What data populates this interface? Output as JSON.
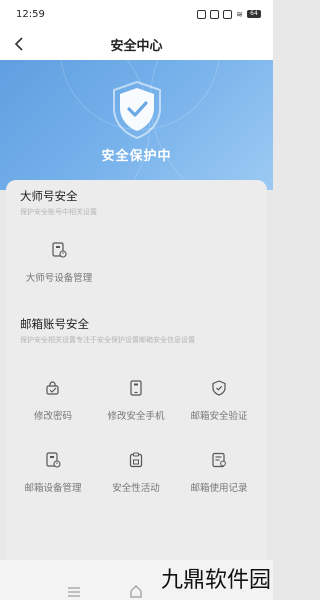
{
  "status_bar": {
    "time": "12:59",
    "battery": "64"
  },
  "nav": {
    "title": "安全中心"
  },
  "hero": {
    "title": "安全保护中"
  },
  "master_section": {
    "title": "大师号安全",
    "description": "保护安全账号中相关设置",
    "items": [
      {
        "label": "大师号设备管理",
        "icon": "device-lock-icon"
      }
    ]
  },
  "mail_section": {
    "title": "邮箱账号安全",
    "description": "保护安全相关设置专注于安全保护设置邮箱安全信息设置",
    "items": [
      {
        "label": "修改密码",
        "icon": "password-edit-icon"
      },
      {
        "label": "修改安全手机",
        "icon": "phone-icon"
      },
      {
        "label": "邮箱安全验证",
        "icon": "shield-check-icon"
      },
      {
        "label": "邮箱设备管理",
        "icon": "device-lock-icon"
      },
      {
        "label": "安全性活动",
        "icon": "clipboard-lock-icon"
      },
      {
        "label": "邮箱使用记录",
        "icon": "record-icon"
      }
    ]
  },
  "watermark": "九鼎软件园",
  "colors": {
    "hero_start": "#5f9ee0",
    "hero_end": "#9ccaf3",
    "panel": "#ececec",
    "icon": "#555555"
  }
}
